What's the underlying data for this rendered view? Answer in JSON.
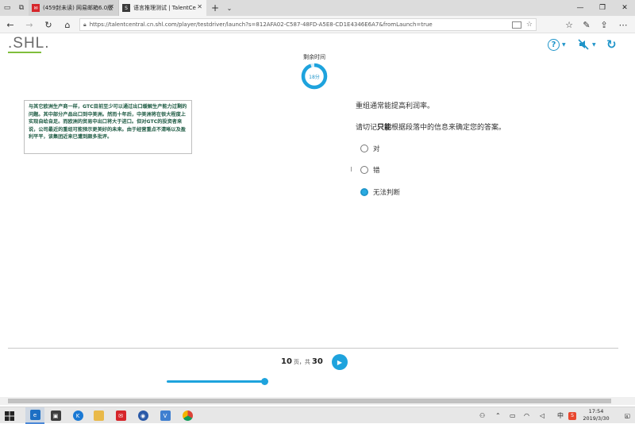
{
  "browser": {
    "tabs": [
      {
        "title": "(459封未读) 网易邮箱6.0版",
        "favicon": "mail-icon",
        "color": "#d6262b"
      },
      {
        "title": "语言推理测试 | TalentCe",
        "favicon": "s-icon",
        "color": "#3a3a3a"
      }
    ],
    "url": "https://talentcentral.cn.shl.com/player/testdriver/launch?s=812AFA02-C587-48FD-A5E8-CD1E4346E6A7&fromLaunch=true"
  },
  "app": {
    "logo": ".SHL.",
    "brand_color": "#1e94c9",
    "logo_underline_color": "#7fbe3c"
  },
  "timer": {
    "label": "剩余时间",
    "value": "18分",
    "fraction_remaining": 0.95
  },
  "passage": {
    "text": "与其它欧洲生产商一样，GTC目前至少可以通过出口缓解生产能力过剩的问题。其中部分产品出口到中美洲。然而十年后，中美洲将在很大程度上实现自给自足。而欧洲的贸易中出口将大于进口。但对GTC的投资者来说，公司最近的重组可能预示更美好的未来。由于经营重点不清晰以及盈利平平，该集团近来已遭到颇多批评。"
  },
  "question": {
    "statement": "重组通常能提高利润率。",
    "instruction_prefix": "请切记",
    "instruction_bold": "只能",
    "instruction_suffix": "根据段落中的信息来确定您的答案。",
    "options": [
      {
        "label": "对",
        "selected": false
      },
      {
        "label": "错",
        "selected": false
      },
      {
        "label": "无法判断",
        "selected": true
      }
    ]
  },
  "footer": {
    "page_current": "10",
    "page_sep": "页，共",
    "page_total": "30",
    "progress_fraction": 0.33
  },
  "taskbar": {
    "ime": "中",
    "time": "17:54",
    "date": "2019/3/30",
    "notifications": "8"
  }
}
